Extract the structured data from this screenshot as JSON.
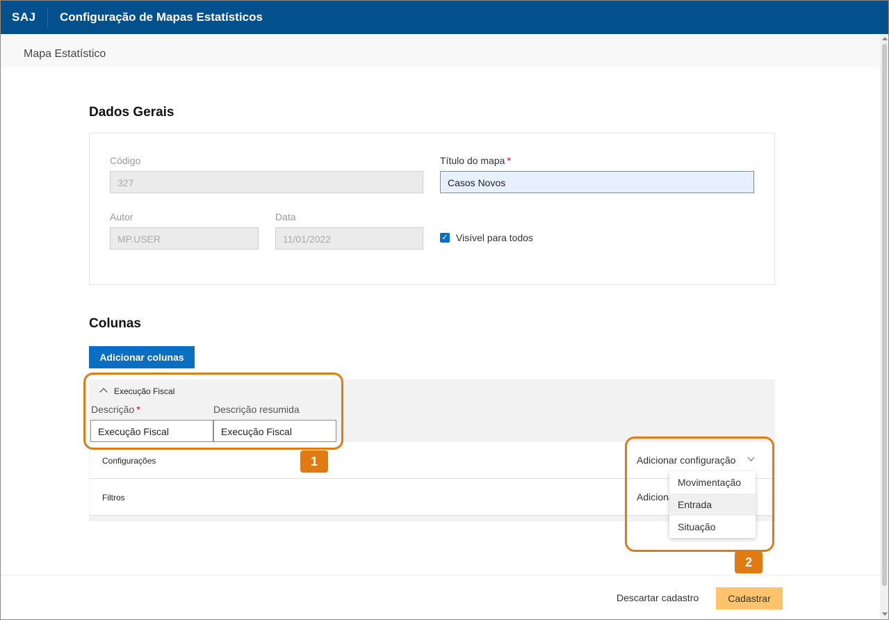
{
  "header": {
    "brand": "SAJ",
    "title": "Configuração de Mapas Estatísticos"
  },
  "subheader": {
    "title": "Mapa Estatístico"
  },
  "general": {
    "section_title": "Dados Gerais",
    "code_label": "Código",
    "code_value": "327",
    "map_title_label": "Título do mapa",
    "map_title_value": "Casos Novos",
    "required_mark": "*",
    "author_label": "Autor",
    "author_value": "MP.USER",
    "date_label": "Data",
    "date_value": "11/01/2022",
    "visible_label": "Visível para todos",
    "visible_checked": true
  },
  "columns": {
    "section_title": "Colunas",
    "add_button": "Adicionar colunas",
    "group_title": "Execução Fiscal",
    "description_label": "Descrição",
    "description_value": "Execução Fiscal",
    "short_description_label": "Descrição resumida",
    "short_description_value": "Execução Fiscal",
    "configurations_label": "Configurações",
    "add_configuration": "Adicionar configuração",
    "filters_label": "Filtros",
    "add_filter_partial": "Adicionar filtro",
    "dropdown_options": [
      "Movimentação",
      "Entrada",
      "Situação"
    ]
  },
  "callouts": {
    "badge_1": "1",
    "badge_2": "2",
    "color": "#e07b13"
  },
  "footer": {
    "discard": "Descartar cadastro",
    "save": "Cadastrar"
  },
  "colors": {
    "primary": "#04508c",
    "button_blue": "#0a6fc2",
    "save_button": "#ffc36b"
  }
}
